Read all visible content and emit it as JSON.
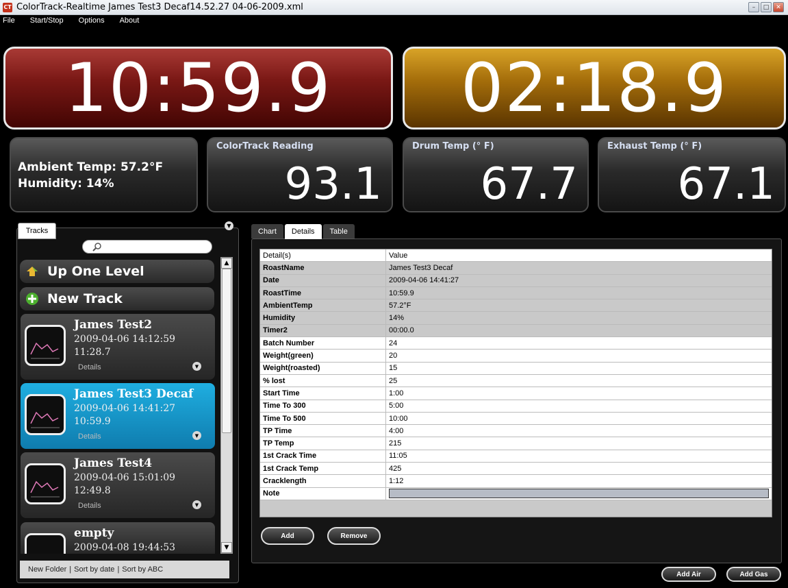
{
  "window": {
    "app_icon": "CT",
    "title": "ColorTrack-Realtime James Test3 Decaf14.52.27 04-06-2009.xml"
  },
  "menu": [
    {
      "label": "File"
    },
    {
      "label": "Start/Stop"
    },
    {
      "label": "Options"
    },
    {
      "label": "About"
    }
  ],
  "timers": {
    "roast_time": "10:59.9",
    "timer2": "02:18.9"
  },
  "readouts": {
    "ambient_temp": "Ambient Temp: 57.2°F",
    "humidity": "Humidity: 14%",
    "colortrack_label": "ColorTrack Reading",
    "colortrack_value": "93.1",
    "drum_label": "Drum Temp (° F)",
    "drum_value": "67.7",
    "exhaust_label": "Exhaust Temp (° F)",
    "exhaust_value": "67.1"
  },
  "tracks": {
    "tab_label": "Tracks",
    "up_one_level": "Up One Level",
    "new_track": "New Track",
    "items": [
      {
        "name": "James Test2",
        "date": "2009-04-06 14:12:59",
        "time": "11:28.7",
        "details": "Details"
      },
      {
        "name": "James Test3 Decaf",
        "date": "2009-04-06 14:41:27",
        "time": "10:59.9",
        "details": "Details"
      },
      {
        "name": "James Test4",
        "date": "2009-04-06 15:01:09",
        "time": "12:49.8",
        "details": "Details"
      },
      {
        "name": "empty",
        "date": "2009-04-08 19:44:53",
        "time": "",
        "details": ""
      }
    ],
    "footer": {
      "new_folder": "New Folder",
      "sort_date": "Sort by date",
      "sort_abc": "Sort by ABC",
      "sep": "|"
    }
  },
  "details_tabs": [
    {
      "label": "Chart"
    },
    {
      "label": "Details"
    },
    {
      "label": "Table"
    }
  ],
  "details_table": {
    "columns": [
      "Detail(s)",
      "Value"
    ],
    "rows": [
      {
        "key": "RoastName",
        "value": "James Test3 Decaf"
      },
      {
        "key": "Date",
        "value": "2009-04-06 14:41:27"
      },
      {
        "key": "RoastTime",
        "value": "10:59.9"
      },
      {
        "key": "AmbientTemp",
        "value": "57.2°F"
      },
      {
        "key": "Humidity",
        "value": "14%"
      },
      {
        "key": "Timer2",
        "value": "00:00.0"
      },
      {
        "key": "Batch Number",
        "value": "24"
      },
      {
        "key": "Weight(green)",
        "value": "20"
      },
      {
        "key": "Weight(roasted)",
        "value": "15"
      },
      {
        "key": "% lost",
        "value": "25"
      },
      {
        "key": "Start Time",
        "value": "1:00"
      },
      {
        "key": "Time To 300",
        "value": "5:00"
      },
      {
        "key": "Time To 500",
        "value": "10:00"
      },
      {
        "key": "TP Time",
        "value": "4:00"
      },
      {
        "key": "TP Temp",
        "value": "215"
      },
      {
        "key": "1st Crack Time",
        "value": "11:05"
      },
      {
        "key": "1st Crack Temp",
        "value": "425"
      },
      {
        "key": "Cracklength",
        "value": "1:12"
      },
      {
        "key": "Note",
        "value": ""
      }
    ]
  },
  "buttons": {
    "add": "Add",
    "remove": "Remove",
    "add_air": "Add Air",
    "add_gas": "Add Gas"
  },
  "colors": {
    "timer_red": "#7a1815",
    "timer_gold": "#a56e0b",
    "selected_track": "#1faee0"
  }
}
